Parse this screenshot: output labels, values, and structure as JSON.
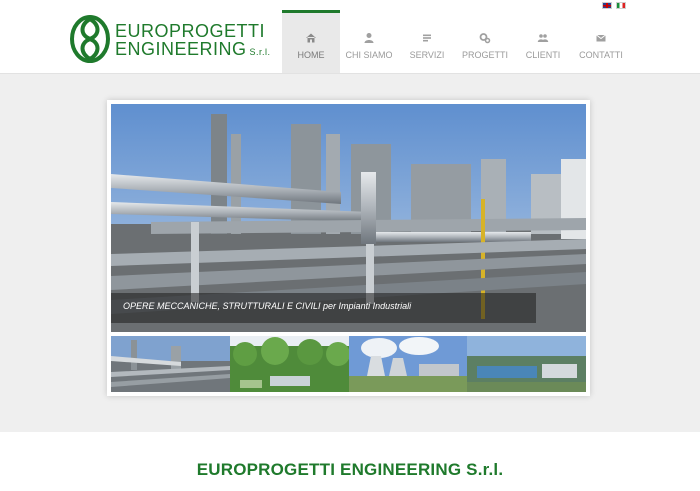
{
  "logo": {
    "line1": "EUROPROGETTI",
    "line2": "ENGINEERING",
    "srl": "S.r.l."
  },
  "nav": {
    "items": [
      {
        "label": "HOME",
        "icon": "home-icon"
      },
      {
        "label": "CHI SIAMO",
        "icon": "user-icon"
      },
      {
        "label": "SERVIZI",
        "icon": "list-icon"
      },
      {
        "label": "PROGETTI",
        "icon": "cogs-icon"
      },
      {
        "label": "CLIENTI",
        "icon": "users-icon"
      },
      {
        "label": "CONTATTI",
        "icon": "envelope-icon"
      }
    ],
    "active_index": 0
  },
  "languages": [
    {
      "code": "en",
      "icon": "uk-flag-icon"
    },
    {
      "code": "it",
      "icon": "italy-flag-icon"
    }
  ],
  "slider": {
    "caption_main": "OPERE MECCANICHE, STRUTTURALI E CIVILI",
    "caption_sub": "per Impianti Industriali",
    "thumbnails": [
      "industrial-plant-thumb",
      "green-forest-thumb",
      "power-plant-thumb",
      "water-treatment-thumb"
    ]
  },
  "footer": {
    "title": "EUROPROGETTI ENGINEERING S.r.l."
  },
  "colors": {
    "brand_green": "#1f7a2c",
    "nav_text": "#9a9a9a",
    "active_bg": "#e9e9e9"
  }
}
